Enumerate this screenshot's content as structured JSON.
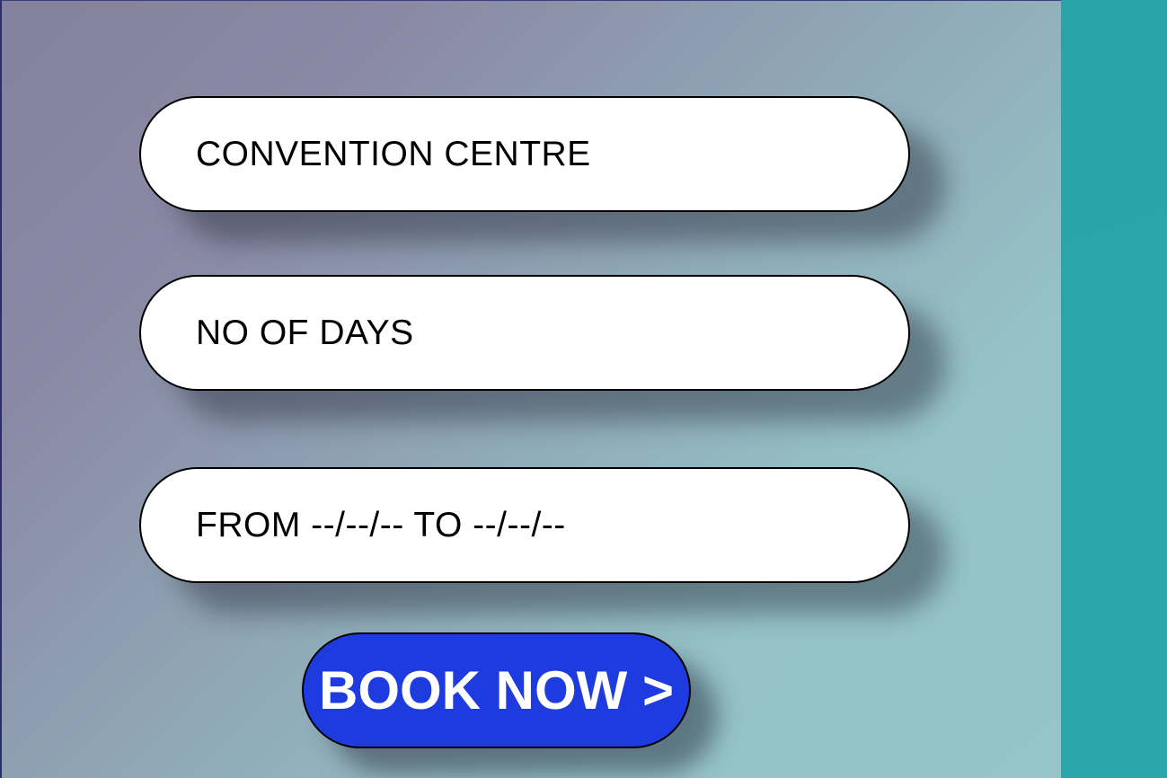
{
  "form": {
    "venue_field": {
      "text": "CONVENTION CENTRE"
    },
    "days_field": {
      "text": "NO OF DAYS"
    },
    "date_range_field": {
      "text": "FROM --/--/-- TO --/--/--"
    },
    "book_button": {
      "label": "BOOK NOW >"
    }
  },
  "colors": {
    "button_bg": "#1e3be0",
    "button_text": "#ffffff",
    "field_bg": "#ffffff",
    "right_strip": "#2ba7aa"
  }
}
